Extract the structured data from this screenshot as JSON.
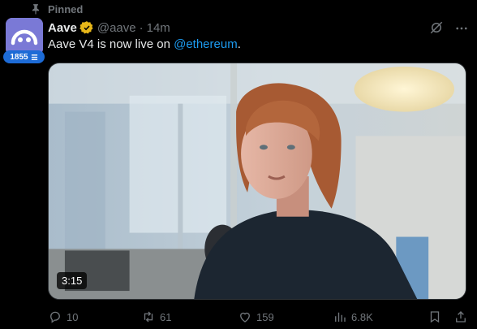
{
  "pinned": {
    "label": "Pinned"
  },
  "author": {
    "display_name": "Aave",
    "handle": "@aave",
    "separator": "·",
    "time": "14m",
    "badge_count": "1855",
    "avatar_color": "#7a79d6",
    "verified_color": "#e8b719"
  },
  "tweet": {
    "text_before": "Aave V4 is now live on ",
    "mention": "@ethereum",
    "text_after": "."
  },
  "media": {
    "duration": "3:15"
  },
  "actions": {
    "replies": "10",
    "reposts": "61",
    "likes": "159",
    "views": "6.8K"
  },
  "icons": [
    "pin-icon",
    "verified-icon",
    "grok-icon",
    "more-icon",
    "reply-icon",
    "repost-icon",
    "like-icon",
    "views-icon",
    "bookmark-icon",
    "share-icon"
  ],
  "colors": {
    "link": "#1d9bf0",
    "muted": "#71767b",
    "text": "#e7e9ea",
    "background": "#000000"
  }
}
